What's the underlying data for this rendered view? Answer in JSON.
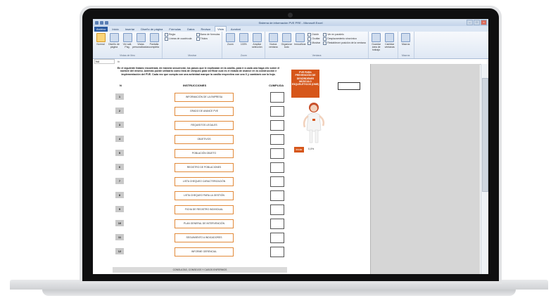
{
  "window": {
    "title": "Sistema de información PVE PRE - Microsoft Excel",
    "controls": [
      "–",
      "□",
      "×"
    ]
  },
  "ribbon": {
    "tabs": [
      "Archivo",
      "Inicio",
      "Insertar",
      "Diseño de página",
      "Fórmulas",
      "Datos",
      "Revisar",
      "Vista",
      "Acrobat"
    ],
    "active_tab": "Vista",
    "groups": [
      {
        "label": "Vistas de libro",
        "buttons": [
          "Normal",
          "Diseño de página",
          "Ver salt. Pág.",
          "Vistas personalizadas",
          "Pantalla completa"
        ]
      },
      {
        "label": "Mostrar",
        "checks": [
          "Regla",
          "Barra de fórmulas",
          "Líneas de cuadrícula",
          "Títulos"
        ]
      },
      {
        "label": "Zoom",
        "buttons": [
          "Zoom",
          "100%",
          "Ampliar selección"
        ]
      },
      {
        "label": "Ventana",
        "buttons": [
          "Nueva ventana",
          "Organizar todo",
          "Inmovilizar"
        ],
        "checks": [
          "Dividir",
          "Ocultar",
          "Mostrar",
          "Ver en paralelo",
          "Desplazamiento sincrónico",
          "Restablecer posición de la ventana"
        ]
      },
      {
        "label": "",
        "buttons": [
          "Guardar área de trabajo",
          "Cambiar ventanas"
        ]
      },
      {
        "label": "Macros",
        "buttons": [
          "Macros"
        ]
      }
    ]
  },
  "formula_bar": {
    "cell": "N4",
    "fx": "fx"
  },
  "sheet": {
    "intro": "En el siguiente listado encontrará, de manera secuencial, los pasos que le explicaran en la casilla, para ir a cada una haga clic sobre el nombre del mismo. Además puede utilizarlo como lista de chequeo para verificar cual es el estado de avance en la construcción e implementación del PVE. Cada vez que cumpla con una actividad marque la casilla respectiva con una X y cambiará con la hoja.",
    "col_num": "N",
    "col_instr": "INSTRUCCIONES",
    "col_done": "CUMPLIDA",
    "rows": [
      {
        "num": "1",
        "label": "INFORMACIÓN DE LA EMPRESA"
      },
      {
        "num": "2",
        "label": "GRADO DE AVANCE PVE"
      },
      {
        "num": "3",
        "label": "REQUISITOS LEGALES"
      },
      {
        "num": "4",
        "label": "OBJETIVOS"
      },
      {
        "num": "5",
        "label": "POBLACIÓN OBJETO"
      },
      {
        "num": "6",
        "label": "REGISTRO DE POBLACIONES"
      },
      {
        "num": "7",
        "label": "LISTA CHEQUEO CARACTERIZACIÓN"
      },
      {
        "num": "8",
        "label": "LISTA CHEQUEO PARA LA GESTIÓN"
      },
      {
        "num": "9",
        "label": "FICHA DE REGISTRO INDIVIDUAL"
      },
      {
        "num": "10",
        "label": "PLAN GENERAL DE INTERVENCIÓN"
      },
      {
        "num": "11",
        "label": "SEGUIMIENTO A INDICADORES"
      },
      {
        "num": "12",
        "label": "INFORME GERENCIAL"
      }
    ],
    "footer": "CONSULTAS, CONSEJOS Y CASOS ENFERMOS",
    "side_box": "PVE PARA PREVENCIÓN DE DESÓRDENES MÚSCULO ESQUELÉTICOS (DME)",
    "side_button": "Iniciar",
    "side_text": "0,0%"
  }
}
